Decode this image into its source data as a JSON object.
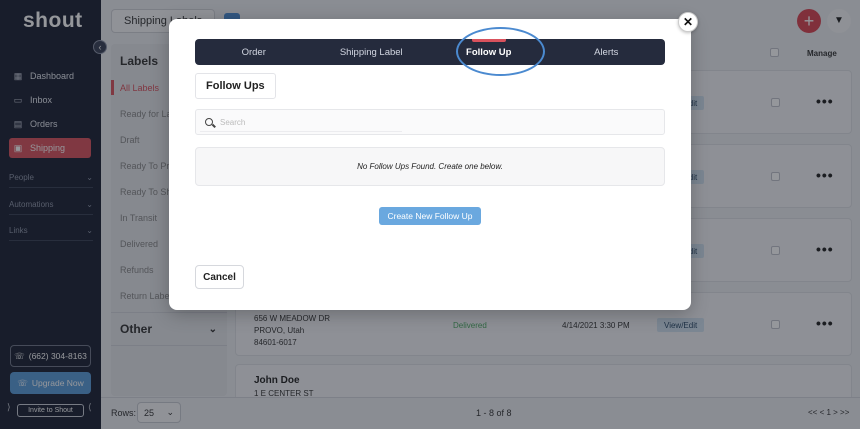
{
  "app": {
    "logo": "shout"
  },
  "sidebar": {
    "items": [
      {
        "label": "Dashboard",
        "icon": "grid-icon"
      },
      {
        "label": "Inbox",
        "icon": "inbox-icon"
      },
      {
        "label": "Orders",
        "icon": "orders-icon"
      },
      {
        "label": "Shipping",
        "icon": "shipping-icon",
        "active": true
      }
    ],
    "groups": [
      "People",
      "Automations",
      "Links"
    ],
    "phone": "(662) 304-8163",
    "upgrade": "Upgrade Now",
    "invite": "Invite to Shout"
  },
  "header": {
    "tab_label": "Shipping Labels",
    "add_symbol": "+",
    "dropdown_symbol": "▼"
  },
  "labels_panel": {
    "title": "Labels",
    "items": [
      "All Labels",
      "Ready for Label",
      "Draft",
      "Ready To Print",
      "Ready To Ship",
      "In Transit",
      "Delivered",
      "Refunds",
      "Return Labels"
    ],
    "other": "Other"
  },
  "table": {
    "manage_header": "Manage",
    "edit_label": "View/Edit",
    "rows": [
      {
        "name": "",
        "address": [],
        "status": "",
        "date": ""
      },
      {
        "name": "",
        "address": [],
        "status": "",
        "date": ""
      },
      {
        "name": "",
        "address": [],
        "status": "",
        "date": ""
      },
      {
        "name": "",
        "address": [
          "656 W MEADOW DR",
          "PROVO, Utah",
          "84601-6017"
        ],
        "status": "Delivered",
        "date": "4/14/2021 3:30 PM"
      },
      {
        "name": "John Doe",
        "address": [
          "1 E CENTER ST"
        ],
        "status": "",
        "date": ""
      }
    ]
  },
  "footer": {
    "rows_label": "Rows:",
    "rows_value": "25",
    "count": "1 - 8 of 8",
    "pager": "<< < 1 > >>"
  },
  "modal": {
    "close_symbol": "✕",
    "tabs": [
      {
        "label": "Order"
      },
      {
        "label": "Shipping Label"
      },
      {
        "label": "Follow Up",
        "active": true
      },
      {
        "label": "Alerts"
      }
    ],
    "section_title": "Follow Ups",
    "search_placeholder": "Search",
    "empty_message": "No Follow Ups Found. Create one below.",
    "create_button": "Create New Follow Up",
    "cancel_button": "Cancel"
  },
  "colors": {
    "sidebar_bg": "#1c2233",
    "accent_red": "#d9525d",
    "accent_blue": "#4b8ad0",
    "button_blue": "#6aa8df",
    "tabbar_bg": "#252b3d",
    "delivered_green": "#4caa62"
  }
}
